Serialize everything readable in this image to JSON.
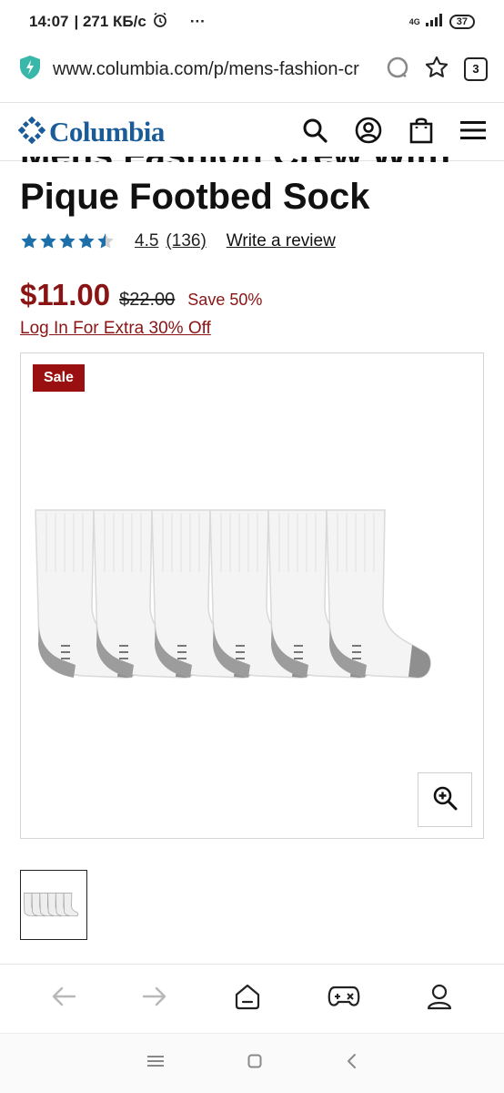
{
  "status_bar": {
    "time": "14:07",
    "speed": "| 271 КБ/с",
    "dots": "···",
    "network": "4G",
    "battery": "37"
  },
  "browser": {
    "url": "www.columbia.com/p/mens-fashion-cr",
    "tab_count": "3"
  },
  "site": {
    "brand": "Columbia",
    "brand_color": "#1a5c99"
  },
  "product": {
    "title_partial": "Mens Fashion Crew With",
    "title": "Pique Footbed Sock",
    "rating": "4.5",
    "rating_value": 4.5,
    "review_count": "(136)",
    "write_review": "Write a review",
    "sale_price": "$11.00",
    "original_price": "$22.00",
    "savings": "Save 50%",
    "login_offer": "Log In For Extra 30% Off",
    "sale_badge": "Sale",
    "sale_color": "#8a1414"
  },
  "icons": {
    "shield": "shield-icon",
    "reload": "reload-icon",
    "star": "star-icon",
    "search": "search-icon",
    "account": "account-icon",
    "bag": "shopping-bag-icon",
    "menu": "hamburger-menu-icon",
    "zoom": "zoom-in-icon",
    "back": "arrow-left-icon",
    "forward": "arrow-right-icon",
    "home": "home-icon",
    "games": "gamepad-icon",
    "profile": "profile-icon"
  }
}
